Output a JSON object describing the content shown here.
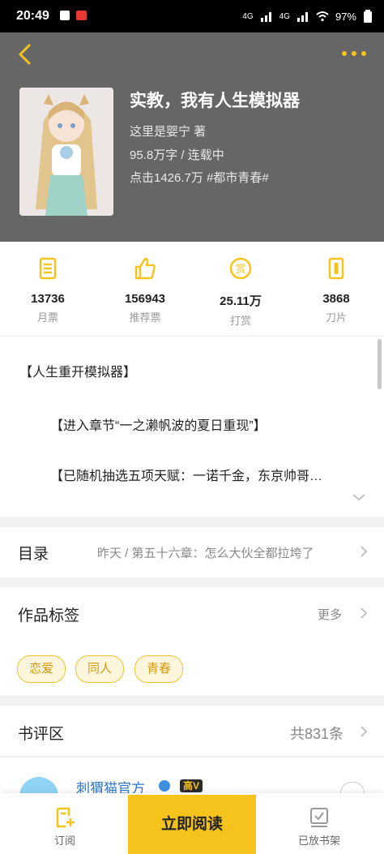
{
  "status_bar": {
    "time": "20:49",
    "network1": "4G",
    "network2": "4G",
    "battery": "97%"
  },
  "book": {
    "title": "实教，我有人生模拟器",
    "author_line": "这里是婴宁  著",
    "word_status": "95.8万字 / 连载中",
    "clicks_category": "点击1426.7万  #都市青春#"
  },
  "stats": [
    {
      "icon": "monthly-ticket-icon",
      "value": "13736",
      "label": "月票"
    },
    {
      "icon": "thumbs-up-icon",
      "value": "156943",
      "label": "推荐票"
    },
    {
      "icon": "reward-icon",
      "value": "25.11万",
      "label": "打赏"
    },
    {
      "icon": "blade-icon",
      "value": "3868",
      "label": "刀片"
    }
  ],
  "synopsis": {
    "line1": "【人生重开模拟器】",
    "line2": "【进入章节“一之濑帆波的夏日重现”】",
    "line3": "【已随机抽选五项天赋：一诺千金，东京帅哥…"
  },
  "toc": {
    "title": "目录",
    "latest": "昨天 / 第五十六章：怎么大伙全都拉垮了"
  },
  "tags": {
    "title": "作品标签",
    "more": "更多",
    "items": [
      "恋爱",
      "同人",
      "青春"
    ]
  },
  "reviews": {
    "title": "书评区",
    "count": "共831条",
    "first_user": "刺猬猫官方",
    "first_badge": "高V"
  },
  "bottom": {
    "subscribe": "订阅",
    "read_now": "立即阅读",
    "shelf": "已放书架"
  },
  "colors": {
    "accent": "#f6c21c",
    "header_bg": "#666666",
    "tag_text": "#d49b12"
  }
}
